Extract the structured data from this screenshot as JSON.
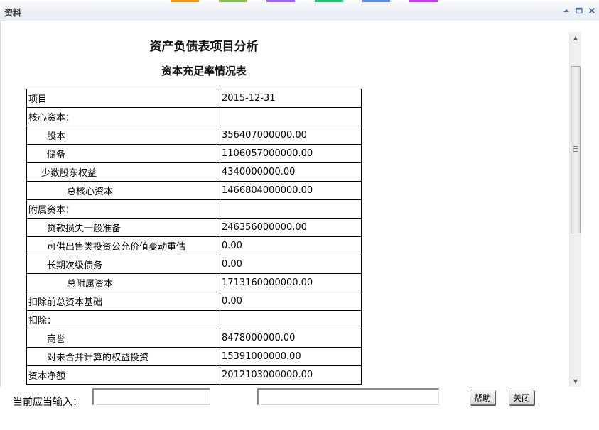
{
  "window": {
    "title": "资料",
    "tools": [
      "minimize-icon",
      "maximize-icon",
      "close-icon"
    ]
  },
  "top_strip_colors": [
    "#ff9900",
    "#8bc34a",
    "#a066ff",
    "#1ec86c",
    "#5b8def",
    "#cc33ff"
  ],
  "report": {
    "title": "资产负债表项目分析",
    "subtitle": "资本充足率情况表",
    "rows": [
      {
        "label": "项目",
        "value": "2015-12-31",
        "indent": 0
      },
      {
        "label": "核心资本：",
        "value": "",
        "indent": 0
      },
      {
        "label": "股本",
        "value": "356407000000.00",
        "indent": 1
      },
      {
        "label": "储备",
        "value": "1106057000000.00",
        "indent": 1
      },
      {
        "label": "少数股东权益",
        "value": "4340000000.00",
        "indent": 3
      },
      {
        "label": "总核心资本",
        "value": "1466804000000.00",
        "indent": 2
      },
      {
        "label": "附属资本：",
        "value": "",
        "indent": 0
      },
      {
        "label": "贷款损失一般准备",
        "value": "246356000000.00",
        "indent": 1
      },
      {
        "label": "可供出售类投资公允价值变动重估",
        "value": "0.00",
        "indent": 1
      },
      {
        "label": "长期次级债务",
        "value": "0.00",
        "indent": 1
      },
      {
        "label": "总附属资本",
        "value": "1713160000000.00",
        "indent": 2
      },
      {
        "label": "扣除前总资本基础",
        "value": "0.00",
        "indent": 0
      },
      {
        "label": "扣除：",
        "value": "",
        "indent": 0
      },
      {
        "label": "商誉",
        "value": "8478000000.00",
        "indent": 1
      },
      {
        "label": "对未合并计算的权益投资",
        "value": "15391000000.00",
        "indent": 1
      },
      {
        "label": "资本净额",
        "value": "2012103000000.00",
        "indent": 0
      }
    ]
  },
  "footer": {
    "input_label": "当前应当输入：",
    "input1_value": "",
    "input2_value": "",
    "help_label": "帮助",
    "close_label": "关闭"
  }
}
